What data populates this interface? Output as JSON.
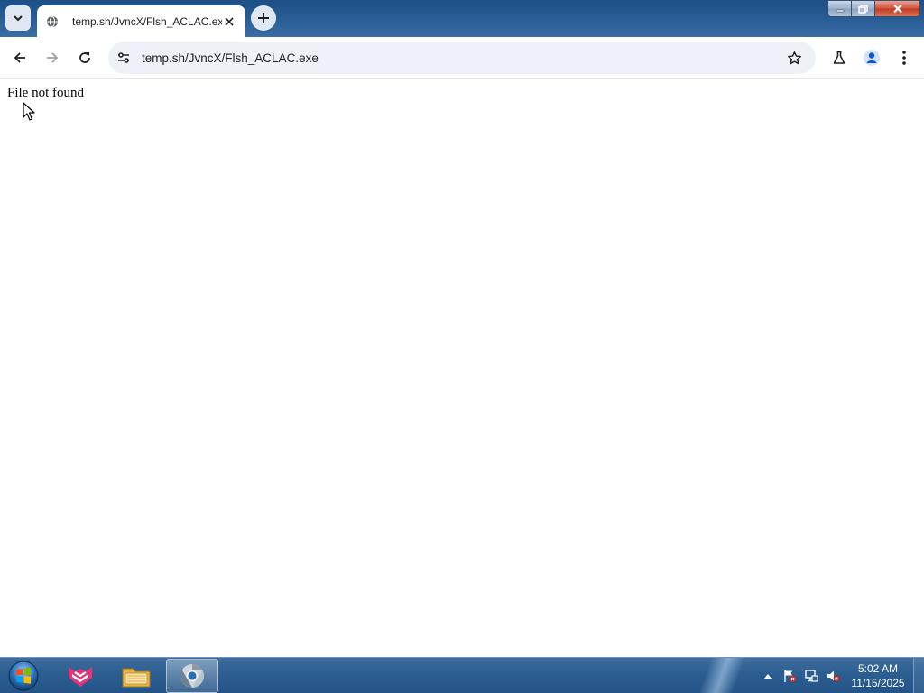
{
  "browser": {
    "tab": {
      "title": "temp.sh/JvncX/Flsh_ACLAC.exe"
    },
    "address_bar": {
      "url": "temp.sh/JvncX/Flsh_ACLAC.exe"
    }
  },
  "page": {
    "message": "File not found"
  },
  "taskbar": {
    "clock": {
      "time": "5:02 AM",
      "date": "11/15/2025"
    }
  },
  "colors": {
    "titlebar": "#2a5e97",
    "omnibox_bg": "#eef1f8",
    "taskbar": "#2d5f92"
  }
}
